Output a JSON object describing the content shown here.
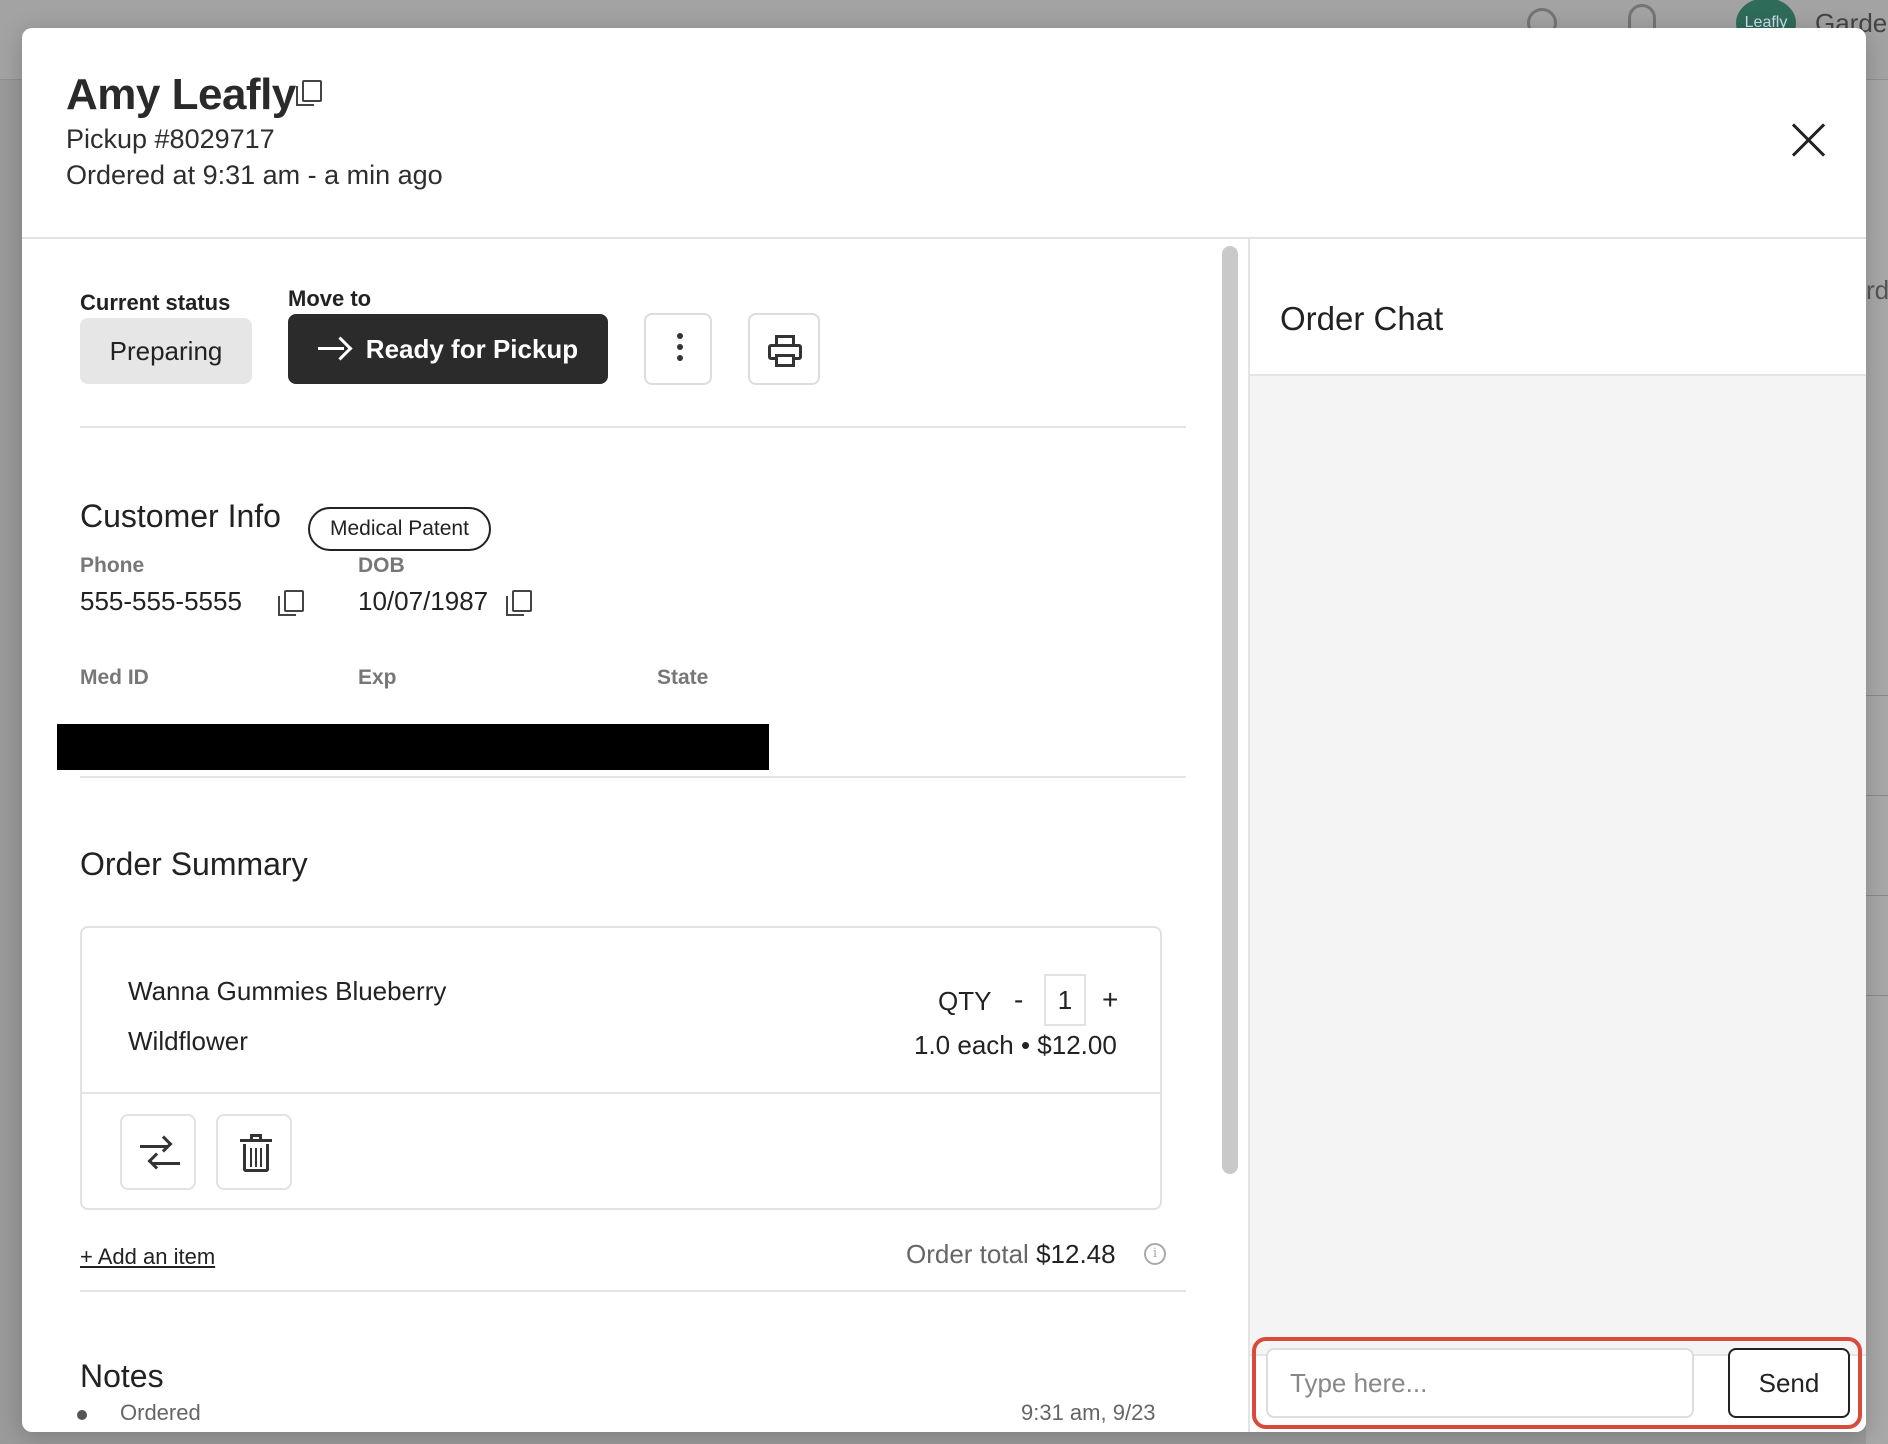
{
  "background": {
    "avatar_text": "Leafly",
    "user_text": "Garde",
    "side_text": "rde"
  },
  "header": {
    "customer_name": "Amy Leafly",
    "pickup": "Pickup #8029717",
    "ordered_at": "Ordered at 9:31 am - a min ago"
  },
  "status": {
    "current_label": "Current status",
    "current_value": "Preparing",
    "move_label": "Move to",
    "move_button": "Ready for Pickup"
  },
  "customer_info": {
    "title": "Customer Info",
    "badge": "Medical Patent",
    "phone_label": "Phone",
    "phone": "555-555-5555",
    "dob_label": "DOB",
    "dob": "10/07/1987",
    "med_id_label": "Med ID",
    "exp_label": "Exp",
    "state_label": "State"
  },
  "order_summary": {
    "title": "Order Summary",
    "items": [
      {
        "name": "Wanna Gummies Blueberry",
        "brand": "Wildflower",
        "qty_label": "QTY",
        "qty_minus": "-",
        "qty": "1",
        "qty_plus": "+",
        "price_line": "1.0 each • $12.00"
      }
    ],
    "add_item": "+ Add an item",
    "total_label": "Order total",
    "total_value": "$12.48"
  },
  "notes": {
    "title": "Notes",
    "entries": [
      {
        "text": "Ordered",
        "time": "9:31 am, 9/23"
      }
    ]
  },
  "chat": {
    "title": "Order Chat",
    "placeholder": "Type here...",
    "send_label": "Send"
  },
  "colors": {
    "primary_button": "#2b2b2b",
    "chat_background": "#f4f4f4",
    "highlight": "#d94a3a",
    "status_chip": "#e6e6e6"
  }
}
